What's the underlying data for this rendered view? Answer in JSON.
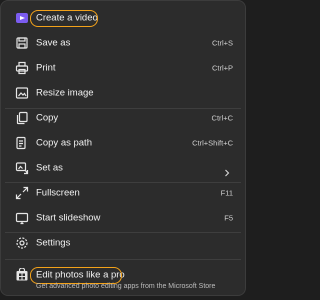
{
  "menu": {
    "items": [
      {
        "label": "Create a video",
        "shortcut": "",
        "icon": "video-editor-icon"
      },
      {
        "label": "Save as",
        "shortcut": "Ctrl+S",
        "icon": "save-as-icon"
      },
      {
        "label": "Print",
        "shortcut": "Ctrl+P",
        "icon": "print-icon"
      },
      {
        "label": "Resize image",
        "shortcut": "",
        "icon": "resize-image-icon"
      },
      {
        "label": "Copy",
        "shortcut": "Ctrl+C",
        "icon": "copy-icon"
      },
      {
        "label": "Copy as path",
        "shortcut": "Ctrl+Shift+C",
        "icon": "copy-path-icon"
      },
      {
        "label": "Set as",
        "shortcut": "",
        "icon": "set-as-icon"
      },
      {
        "label": "Fullscreen",
        "shortcut": "F11",
        "icon": "fullscreen-icon"
      },
      {
        "label": "Start slideshow",
        "shortcut": "F5",
        "icon": "slideshow-icon"
      },
      {
        "label": "Settings",
        "shortcut": "",
        "icon": "gear-icon"
      }
    ],
    "promo": {
      "label": "Edit photos like a pro",
      "subtitle": "Get advanced photo editing apps from the Microsoft Store",
      "icon": "store-icon"
    }
  },
  "colors": {
    "menu_background": "#2c2c2c",
    "highlight_ring": "#f3a21a",
    "video_icon_accent": "#7b5cf0"
  }
}
